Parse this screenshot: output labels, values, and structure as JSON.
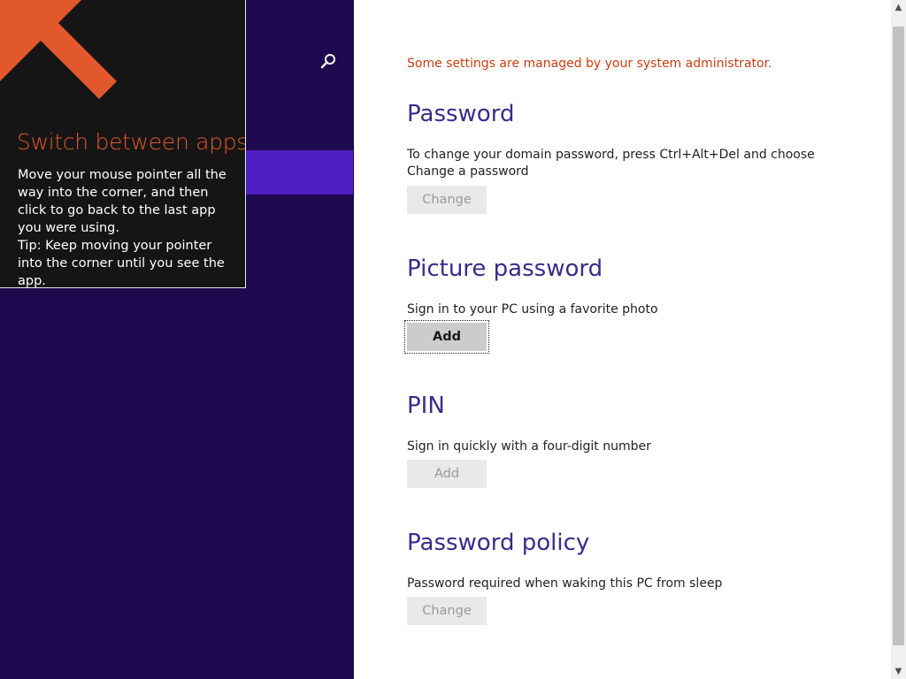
{
  "tip": {
    "title": "Switch between apps",
    "body_line1": "Move your mouse pointer all the way into the corner, and then click to go back to the last app you were using.",
    "body_line2": "Tip: Keep moving your pointer into the corner until you see the app.",
    "arrow_icon": "arrow-up-left-icon"
  },
  "nav": {
    "search_icon": "search-icon"
  },
  "content": {
    "admin_note": "Some settings are managed by your system administrator.",
    "password": {
      "title": "Password",
      "desc": "To change your domain password, press Ctrl+Alt+Del and choose Change a password",
      "button": "Change"
    },
    "picture_password": {
      "title": "Picture password",
      "desc": "Sign in to your PC using a favorite photo",
      "button": "Add"
    },
    "pin": {
      "title": "PIN",
      "desc": "Sign in quickly with a four-digit number",
      "button": "Add"
    },
    "password_policy": {
      "title": "Password policy",
      "desc": "Password required when waking this PC from sleep",
      "button": "Change"
    }
  },
  "scrollbar": {
    "up": "▲",
    "down": "▼"
  },
  "colors": {
    "nav_background": "#1f0a4f",
    "nav_selected": "#4e1ec2",
    "accent_orange": "#e0582c",
    "heading_purple": "#3d2a8a",
    "admin_note": "#cc3d0e"
  }
}
